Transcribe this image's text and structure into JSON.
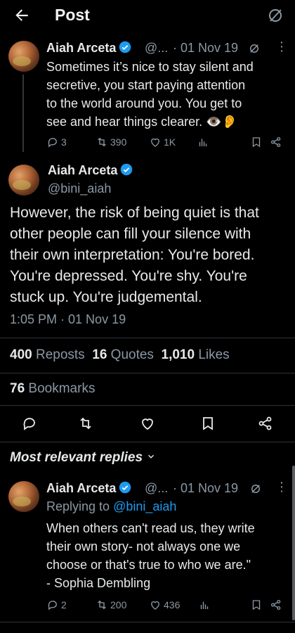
{
  "header": {
    "title": "Post"
  },
  "parent_post": {
    "name": "Aiah Arceta",
    "handle_truncated": "@...",
    "date": "· 01 Nov 19",
    "lines": [
      "Sometimes it’s nice to stay silent and",
      "secretive, you start paying attention",
      "to the world around you. You get to",
      "see and hear things clearer. 👁️👂"
    ],
    "replies": "3",
    "reposts": "390",
    "likes": "1K"
  },
  "main_post": {
    "name": "Aiah Arceta",
    "handle": "@bini_aiah",
    "lines": [
      "However, the risk of being quiet is that",
      "other people can fill your silence with",
      "their own interpretation: You're bored.",
      "You're depressed. You're shy. You're",
      "stuck up. You're judgemental."
    ],
    "timestamp": "1:05 PM · 01 Nov 19",
    "reposts_count": "400",
    "reposts_label": "Reposts",
    "quotes_count": "16",
    "quotes_label": "Quotes",
    "likes_count": "1,010",
    "likes_label": "Likes",
    "bookmarks_count": "76",
    "bookmarks_label": "Bookmarks"
  },
  "replies_section": {
    "label": "Most relevant replies"
  },
  "reply": {
    "name": "Aiah Arceta",
    "handle_truncated": "@...",
    "date": "· 01 Nov 19",
    "replying_prefix": "Replying to",
    "replying_handle": "@bini_aiah",
    "lines": [
      "When others can't read us, they write",
      "their own story- not always one we",
      "choose or that's true to who we are.\"",
      "- Sophia Dembling"
    ],
    "replies": "2",
    "reposts": "200",
    "likes": "436"
  },
  "colors": {
    "accent": "#1d9bf0",
    "muted": "#8b98a5",
    "background": "#000000"
  }
}
